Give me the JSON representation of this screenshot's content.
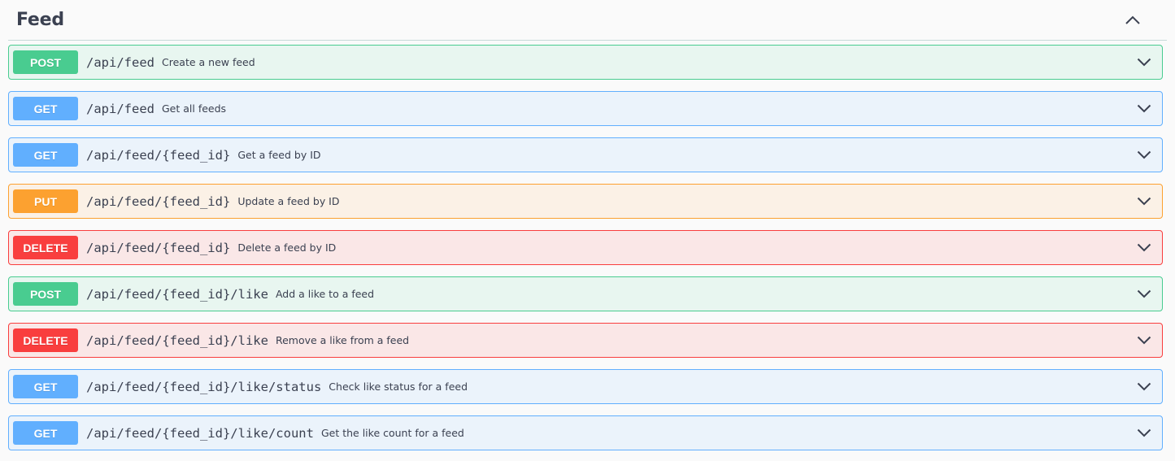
{
  "section": {
    "title": "Feed",
    "collapse_icon": "chevron-up-icon"
  },
  "operations": [
    {
      "method": "POST",
      "path": "/api/feed",
      "summary": "Create a new feed"
    },
    {
      "method": "GET",
      "path": "/api/feed",
      "summary": "Get all feeds"
    },
    {
      "method": "GET",
      "path": "/api/feed/{feed_id}",
      "summary": "Get a feed by ID"
    },
    {
      "method": "PUT",
      "path": "/api/feed/{feed_id}",
      "summary": "Update a feed by ID"
    },
    {
      "method": "DELETE",
      "path": "/api/feed/{feed_id}",
      "summary": "Delete a feed by ID"
    },
    {
      "method": "POST",
      "path": "/api/feed/{feed_id}/like",
      "summary": "Add a like to a feed"
    },
    {
      "method": "DELETE",
      "path": "/api/feed/{feed_id}/like",
      "summary": "Remove a like from a feed"
    },
    {
      "method": "GET",
      "path": "/api/feed/{feed_id}/like/status",
      "summary": "Check like status for a feed"
    },
    {
      "method": "GET",
      "path": "/api/feed/{feed_id}/like/count",
      "summary": "Get the like count for a feed"
    }
  ],
  "colors": {
    "post": "#49cc90",
    "get": "#61affe",
    "put": "#fca130",
    "delete": "#f93e3e"
  },
  "icons": {
    "expand": "chevron-down-icon"
  }
}
